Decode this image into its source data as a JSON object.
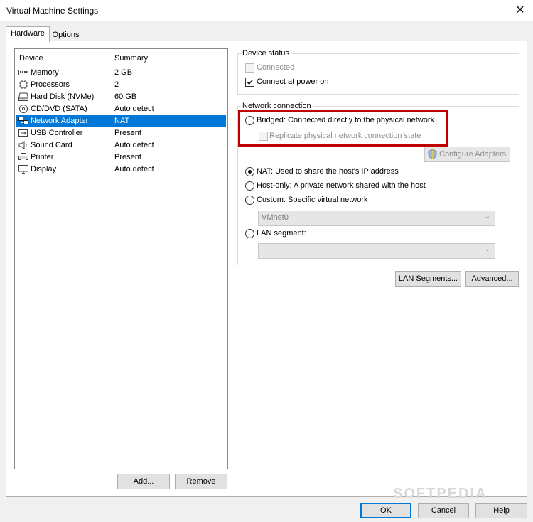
{
  "window": {
    "title": "Virtual Machine Settings",
    "close_glyph": "✕"
  },
  "tabs": [
    {
      "label": "Hardware"
    },
    {
      "label": "Options"
    }
  ],
  "device_list": {
    "columns": {
      "device": "Device",
      "summary": "Summary"
    },
    "rows": [
      {
        "icon": "memory-icon",
        "name": "Memory",
        "summary": "2 GB"
      },
      {
        "icon": "processor-icon",
        "name": "Processors",
        "summary": "2"
      },
      {
        "icon": "hard-disk-icon",
        "name": "Hard Disk (NVMe)",
        "summary": "60 GB"
      },
      {
        "icon": "cd-dvd-icon",
        "name": "CD/DVD (SATA)",
        "summary": "Auto detect"
      },
      {
        "icon": "network-adapter-icon",
        "name": "Network Adapter",
        "summary": "NAT"
      },
      {
        "icon": "usb-icon",
        "name": "USB Controller",
        "summary": "Present"
      },
      {
        "icon": "sound-card-icon",
        "name": "Sound Card",
        "summary": "Auto detect"
      },
      {
        "icon": "printer-icon",
        "name": "Printer",
        "summary": "Present"
      },
      {
        "icon": "display-icon",
        "name": "Display",
        "summary": "Auto detect"
      }
    ],
    "selected_index": 4
  },
  "list_buttons": {
    "add": "Add...",
    "remove": "Remove"
  },
  "device_status": {
    "label": "Device status",
    "connected": "Connected",
    "connect_at_power_on": "Connect at power on"
  },
  "network_connection": {
    "label": "Network connection",
    "bridged": "Bridged: Connected directly to the physical network",
    "replicate": "Replicate physical network connection state",
    "configure_adapters": "Configure Adapters",
    "nat": "NAT: Used to share the host's IP address",
    "host_only": "Host-only: A private network shared with the host",
    "custom": "Custom: Specific virtual network",
    "custom_value": "VMnet0",
    "lan_segment": "LAN segment:",
    "lan_value": ""
  },
  "right_buttons": {
    "lan_segments": "LAN Segments...",
    "advanced": "Advanced..."
  },
  "dialog_buttons": {
    "ok": "OK",
    "cancel": "Cancel",
    "help": "Help"
  },
  "watermark": "SOFTPEDIA",
  "colors": {
    "selection": "#0078d7",
    "highlight_box": "#c00000"
  }
}
